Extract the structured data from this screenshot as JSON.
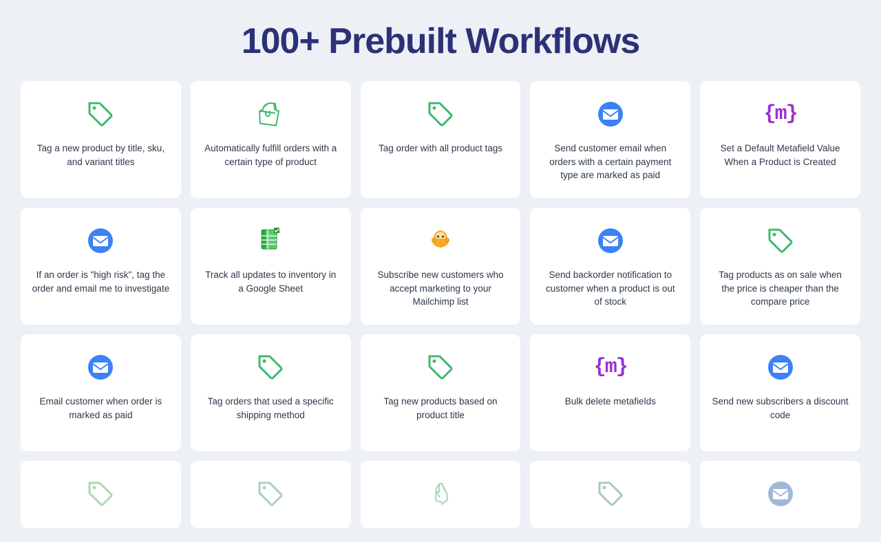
{
  "page": {
    "title": "100+ Prebuilt Workflows",
    "background": "#edf0f5"
  },
  "cards": [
    {
      "id": "card-1",
      "icon_type": "tag",
      "icon_color": "#3dba6e",
      "text": "Tag a new product by title, sku, and variant titles"
    },
    {
      "id": "card-2",
      "icon_type": "shopify",
      "icon_color": "#3dba6e",
      "text": "Automatically fulfill orders with a certain type of product"
    },
    {
      "id": "card-3",
      "icon_type": "tag",
      "icon_color": "#3dba6e",
      "text": "Tag order with all product tags"
    },
    {
      "id": "card-4",
      "icon_type": "email",
      "icon_color": "#3b82f6",
      "text": "Send customer email when orders with a certain payment type are marked as paid"
    },
    {
      "id": "card-5",
      "icon_type": "metafield",
      "icon_color": "#9b30d4",
      "text": "Set a Default Metafield Value When a Product is Created"
    },
    {
      "id": "card-6",
      "icon_type": "email",
      "icon_color": "#3b82f6",
      "text": "If an order is \"high risk\", tag the order and email me to investigate"
    },
    {
      "id": "card-7",
      "icon_type": "sheets",
      "icon_color": "#2ba83e",
      "text": "Track all updates to inventory in a Google Sheet"
    },
    {
      "id": "card-8",
      "icon_type": "mailchimp",
      "icon_color": "#f9a827",
      "text": "Subscribe new customers who accept marketing to your Mailchimp list"
    },
    {
      "id": "card-9",
      "icon_type": "email",
      "icon_color": "#3b82f6",
      "text": "Send backorder notification to customer when a product is out of stock"
    },
    {
      "id": "card-10",
      "icon_type": "tag",
      "icon_color": "#3dba6e",
      "text": "Tag products as on sale when the price is cheaper than the compare price"
    },
    {
      "id": "card-11",
      "icon_type": "email",
      "icon_color": "#3b82f6",
      "text": "Email customer when order is marked as paid"
    },
    {
      "id": "card-12",
      "icon_type": "tag",
      "icon_color": "#3dba6e",
      "text": "Tag orders that used a specific shipping method"
    },
    {
      "id": "card-13",
      "icon_type": "tag",
      "icon_color": "#3dba6e",
      "text": "Tag new products based on product title"
    },
    {
      "id": "card-14",
      "icon_type": "metafield",
      "icon_color": "#9b30d4",
      "text": "Bulk delete metafields"
    },
    {
      "id": "card-15",
      "icon_type": "email",
      "icon_color": "#3b82f6",
      "text": "Send new subscribers a discount code"
    },
    {
      "id": "card-16",
      "icon_type": "tag",
      "icon_color": "#aad9b5",
      "text": ""
    },
    {
      "id": "card-17",
      "icon_type": "tag",
      "icon_color": "#aacec8",
      "text": ""
    },
    {
      "id": "card-18",
      "icon_type": "touch",
      "icon_color": "#aad9b5",
      "text": ""
    },
    {
      "id": "card-19",
      "icon_type": "tag",
      "icon_color": "#aac8c4",
      "text": ""
    },
    {
      "id": "card-20",
      "icon_type": "email",
      "icon_color": "#a0b8d8",
      "text": ""
    }
  ]
}
